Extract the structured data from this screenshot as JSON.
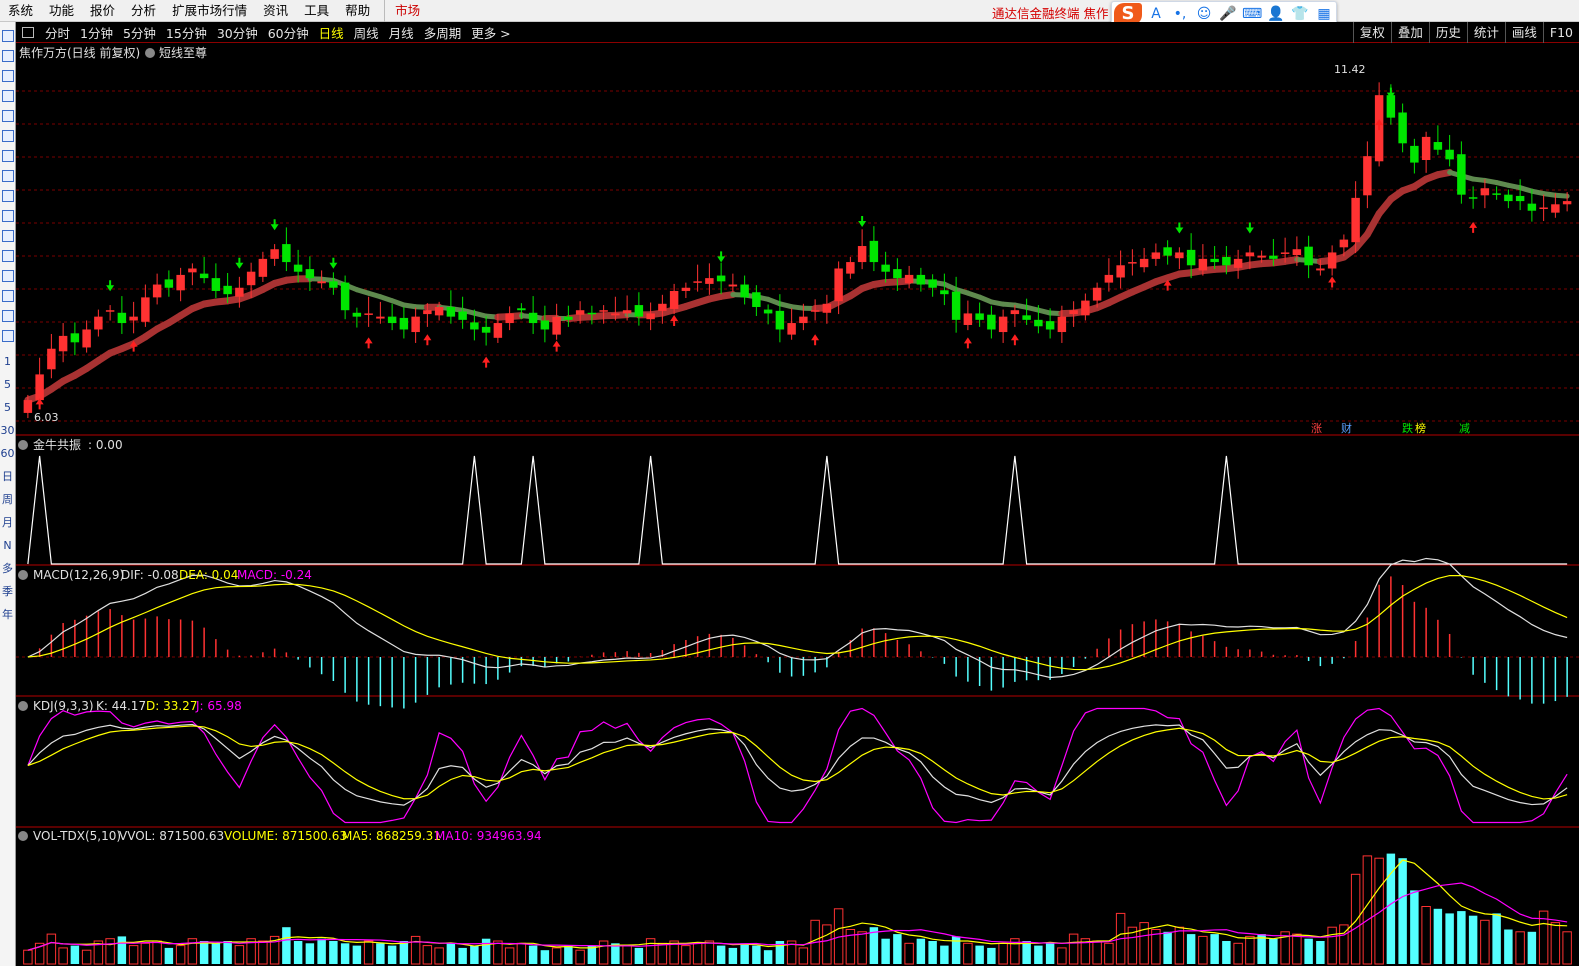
{
  "menu": {
    "items": [
      "系统",
      "功能",
      "报价",
      "分析",
      "扩展市场行情",
      "资讯",
      "工具",
      "帮助"
    ],
    "market": "市场",
    "brand": "通达信金融终端  焦作"
  },
  "toolbar": {
    "periods": [
      "分时",
      "1分钟",
      "5分钟",
      "15分钟",
      "30分钟",
      "60分钟",
      "日线",
      "周线",
      "月线",
      "多周期",
      "更多 >"
    ],
    "active": "日线",
    "right": [
      "复权",
      "叠加",
      "历史",
      "统计",
      "画线",
      "F10"
    ]
  },
  "sidebar": {
    "labels": [
      "1",
      "5",
      "5",
      "30",
      "60",
      "日",
      "周",
      "月",
      "N",
      "多",
      "季",
      "年"
    ]
  },
  "colors": {
    "up": "#ff3232",
    "down": "#00e600",
    "grid": "#7a0000",
    "cyan": "#54ffff",
    "yellow": "#ffff00",
    "magenta": "#ff00ff",
    "white": "#e0e0e0"
  },
  "panels": {
    "main": {
      "stock": "焦作万方(日线 前复权)",
      "indicator": "短线至尊",
      "high_label": "11.42",
      "low_label": "6.03",
      "markers": [
        {
          "text": "涨",
          "color": "#ff4040"
        },
        {
          "text": "财",
          "color": "#5aa0ff"
        },
        {
          "text": "跌",
          "color": "#00e600"
        },
        {
          "text": "榜",
          "color": "#ffff00"
        },
        {
          "text": "减",
          "color": "#00e600"
        }
      ]
    },
    "jnjz": {
      "name": "金牛共振",
      "value": ": 0.00"
    },
    "macd": {
      "name": "MACD(12,26,9)",
      "dif": "DIF: -0.08",
      "dea": "DEA: 0.04",
      "macd": "MACD: -0.24"
    },
    "kdj": {
      "name": "KDJ(9,3,3)",
      "k": "K: 44.17",
      "d": "D: 33.27",
      "j": "J: 65.98"
    },
    "vol": {
      "name": "VOL-TDX(5,10)",
      "vvol": "VVOL: 871500.63",
      "volume": "VOLUME: 871500.63",
      "ma5": "MA5: 868259.31",
      "ma10": "MA10: 934963.94"
    }
  },
  "chart_data": {
    "type": "candlestick",
    "price_range": [
      6.03,
      11.42
    ],
    "closes": [
      6.2,
      6.6,
      7.0,
      7.2,
      7.1,
      7.3,
      7.5,
      7.6,
      7.4,
      7.5,
      7.8,
      8.0,
      7.95,
      8.15,
      8.25,
      8.1,
      7.9,
      7.85,
      7.95,
      8.2,
      8.4,
      8.55,
      8.35,
      8.2,
      8.1,
      8.05,
      7.95,
      7.6,
      7.5,
      7.55,
      7.5,
      7.4,
      7.3,
      7.5,
      7.6,
      7.65,
      7.5,
      7.45,
      7.3,
      7.25,
      7.4,
      7.55,
      7.6,
      7.4,
      7.3,
      7.5,
      7.45,
      7.6,
      7.55,
      7.6,
      7.55,
      7.6,
      7.5,
      7.55,
      7.7,
      7.9,
      7.95,
      8.05,
      8.1,
      8.05,
      8.0,
      7.8,
      7.65,
      7.55,
      7.3,
      7.4,
      7.5,
      7.6,
      7.7,
      8.25,
      8.35,
      8.6,
      8.35,
      8.2,
      8.1,
      8.15,
      8.0,
      7.95,
      7.85,
      7.45,
      7.55,
      7.45,
      7.3,
      7.5,
      7.6,
      7.45,
      7.35,
      7.3,
      7.5,
      7.6,
      7.75,
      7.95,
      8.15,
      8.3,
      8.35,
      8.4,
      8.5,
      8.45,
      8.5,
      8.3,
      8.4,
      8.35,
      8.3,
      8.4,
      8.5,
      8.45,
      8.4,
      8.5,
      8.55,
      8.3,
      8.25,
      8.5,
      8.7,
      9.35,
      10.0,
      10.95,
      10.6,
      10.2,
      9.9,
      10.3,
      10.1,
      9.95,
      9.4,
      9.35,
      9.5,
      9.4,
      9.3,
      9.3,
      9.15,
      9.2,
      9.25,
      9.3
    ],
    "volume_scale_max": 1.0,
    "volumes": [
      0.12,
      0.18,
      0.26,
      0.14,
      0.16,
      0.12,
      0.2,
      0.22,
      0.24,
      0.16,
      0.18,
      0.2,
      0.14,
      0.16,
      0.22,
      0.2,
      0.18,
      0.2,
      0.16,
      0.22,
      0.2,
      0.24,
      0.32,
      0.2,
      0.18,
      0.22,
      0.2,
      0.18,
      0.16,
      0.2,
      0.18,
      0.16,
      0.2,
      0.24,
      0.16,
      0.14,
      0.18,
      0.14,
      0.16,
      0.22,
      0.2,
      0.14,
      0.18,
      0.16,
      0.12,
      0.14,
      0.16,
      0.12,
      0.16,
      0.2,
      0.18,
      0.16,
      0.14,
      0.22,
      0.18,
      0.2,
      0.16,
      0.18,
      0.2,
      0.16,
      0.14,
      0.18,
      0.16,
      0.12,
      0.2,
      0.2,
      0.14,
      0.38,
      0.34,
      0.48,
      0.3,
      0.28,
      0.32,
      0.22,
      0.26,
      0.18,
      0.22,
      0.2,
      0.16,
      0.24,
      0.18,
      0.16,
      0.14,
      0.18,
      0.22,
      0.2,
      0.16,
      0.18,
      0.14,
      0.26,
      0.22,
      0.2,
      0.18,
      0.44,
      0.32,
      0.36,
      0.3,
      0.28,
      0.32,
      0.26,
      0.24,
      0.26,
      0.2,
      0.18,
      0.24,
      0.26,
      0.22,
      0.28,
      0.26,
      0.22,
      0.2,
      0.32,
      0.34,
      0.78,
      0.94,
      0.92,
      0.96,
      0.92,
      0.64,
      0.5,
      0.48,
      0.44,
      0.46,
      0.42,
      0.38,
      0.44,
      0.3,
      0.28,
      0.28,
      0.46,
      0.36,
      0.28
    ]
  }
}
